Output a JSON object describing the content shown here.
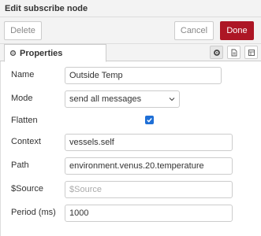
{
  "tray": {
    "title": "Edit subscribe node"
  },
  "toolbar": {
    "delete_label": "Delete",
    "cancel_label": "Cancel",
    "done_label": "Done"
  },
  "tabs": {
    "properties_label": "Properties",
    "icons": [
      "gear-icon",
      "description-icon",
      "appearance-icon"
    ]
  },
  "form": {
    "name": {
      "label": "Name",
      "value": "Outside Temp"
    },
    "mode": {
      "label": "Mode",
      "value": "send all messages"
    },
    "flatten": {
      "label": "Flatten",
      "checked": true
    },
    "context": {
      "label": "Context",
      "value": "vessels.self"
    },
    "path": {
      "label": "Path",
      "value": "environment.venus.20.temperature"
    },
    "source": {
      "label": "$Source",
      "value": "",
      "placeholder": "$Source"
    },
    "period": {
      "label": "Period (ms)",
      "value": "1000"
    }
  },
  "colors": {
    "accent": "#ad1625",
    "checkbox": "#1f6fd6",
    "header_bg": "#f3f3f3"
  }
}
